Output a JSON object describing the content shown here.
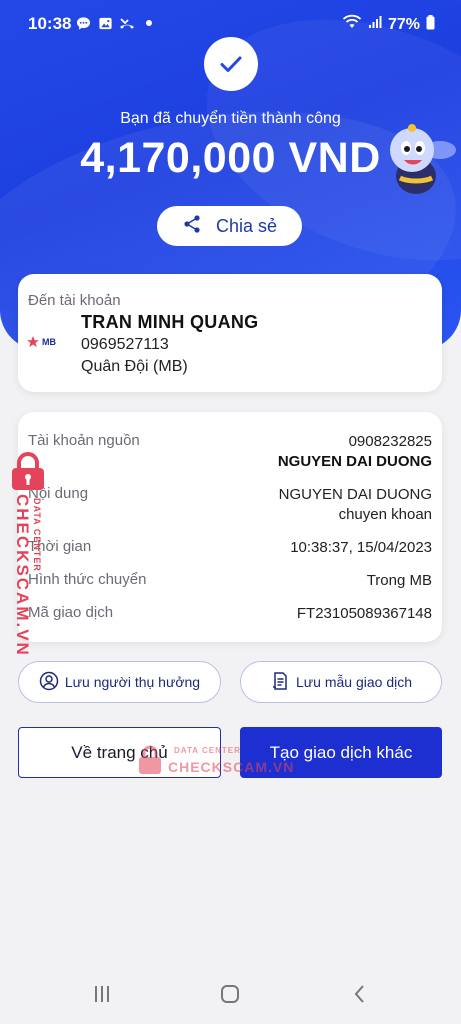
{
  "status_bar": {
    "time": "10:38",
    "battery": "77%",
    "left_icons": [
      "chat-icon",
      "gallery-icon",
      "missed-call-icon",
      "dot-icon"
    ],
    "right_icons": [
      "wifi-icon",
      "signal-icon",
      "battery-icon"
    ]
  },
  "hero": {
    "title": "Bạn đã chuyển tiền thành công",
    "amount": "4,170,000 VND",
    "share_label": "Chia sẻ"
  },
  "recipient": {
    "label": "Đến tài khoản",
    "bank_logo": "MB",
    "name": "TRAN MINH QUANG",
    "account": "0969527113",
    "bank": "Quân Đội (MB)"
  },
  "details": {
    "source_label": "Tài khoản nguồn",
    "source_account": "0908232825",
    "source_name": "NGUYEN DAI DUONG",
    "content_label": "Nội dung",
    "content_line1": "NGUYEN DAI DUONG",
    "content_line2": "chuyen khoan",
    "time_label": "Thời gian",
    "time_value": "10:38:37, 15/04/2023",
    "method_label": "Hình thức chuyển",
    "method_value": "Trong MB",
    "txn_label": "Mã giao dịch",
    "txn_value": "FT23105089367148"
  },
  "actions": {
    "save_beneficiary": "Lưu người thụ hưởng",
    "save_template": "Lưu mẫu giao dịch",
    "home": "Về trang chủ",
    "new_transaction": "Tạo giao dịch khác"
  },
  "watermark": {
    "brand": "CHECKSCAM.VN",
    "sub": "DATA CENTER"
  },
  "colors": {
    "primary": "#1d2fd0",
    "hero": "#2448e8",
    "watermark": "#e3445a"
  }
}
